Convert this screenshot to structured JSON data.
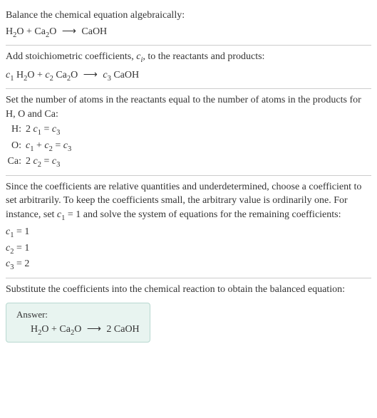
{
  "section1": {
    "instruction": "Balance the chemical equation algebraically:",
    "eq_h2o": "H",
    "eq_h2o_sub": "2",
    "eq_h2o_o": "O + Ca",
    "eq_ca_sub": "2",
    "eq_rest": "O ",
    "eq_arrow": "⟶",
    "eq_product": " CaOH"
  },
  "section2": {
    "instruction_part1": "Add stoichiometric coefficients, ",
    "ci": "c",
    "ci_sub": "i",
    "instruction_part2": ", to the reactants and products:",
    "c1": "c",
    "c1_sub": "1",
    "sp1": " H",
    "h2_sub": "2",
    "sp2": "O + ",
    "c2": "c",
    "c2_sub": "2",
    "sp3": " Ca",
    "ca2_sub": "2",
    "sp4": "O ",
    "arrow": "⟶",
    "sp5": " ",
    "c3": "c",
    "c3_sub": "3",
    "sp6": " CaOH"
  },
  "section3": {
    "instruction": "Set the number of atoms in the reactants equal to the number of atoms in the products for H, O and Ca:",
    "rows": [
      {
        "label": "H:",
        "lhs1": "2 ",
        "c1": "c",
        "c1s": "1",
        "mid": " = ",
        "c2": "c",
        "c2s": "3"
      },
      {
        "label": "O:",
        "lhs1": "",
        "c1": "c",
        "c1s": "1",
        "plus": " + ",
        "cb": "c",
        "cbs": "2",
        "mid": " = ",
        "c2": "c",
        "c2s": "3"
      },
      {
        "label": "Ca:",
        "lhs1": "2 ",
        "c1": "c",
        "c1s": "2",
        "mid": " = ",
        "c2": "c",
        "c2s": "3"
      }
    ]
  },
  "section4": {
    "instruction_p1": "Since the coefficients are relative quantities and underdetermined, choose a coefficient to set arbitrarily. To keep the coefficients small, the arbitrary value is ordinarily one. For instance, set ",
    "cvar": "c",
    "cvar_sub": "1",
    "instruction_p2": " = 1 and solve the system of equations for the remaining coefficients:",
    "lines": [
      {
        "c": "c",
        "cs": "1",
        "rest": " = 1"
      },
      {
        "c": "c",
        "cs": "2",
        "rest": " = 1"
      },
      {
        "c": "c",
        "cs": "3",
        "rest": " = 2"
      }
    ]
  },
  "section5": {
    "instruction": "Substitute the coefficients into the chemical reaction to obtain the balanced equation:",
    "answer_label": "Answer:",
    "eq_p1": "H",
    "eq_s1": "2",
    "eq_p2": "O + Ca",
    "eq_s2": "2",
    "eq_p3": "O ",
    "arrow": "⟶",
    "eq_p4": " 2 CaOH"
  }
}
